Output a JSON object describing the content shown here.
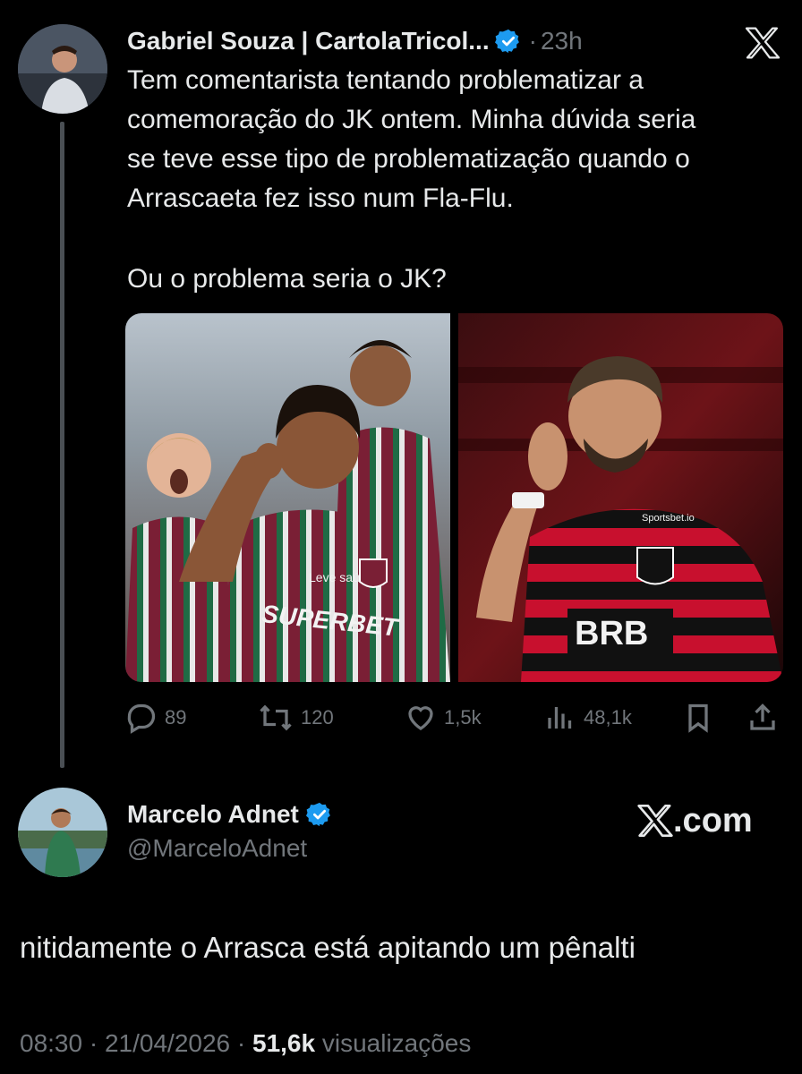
{
  "parent_tweet": {
    "author_name": "Gabriel Souza | CartolaTricol...",
    "time": "23h",
    "text_lines": [
      "Tem comentarista tentando problematizar a",
      "comemoração do JK ontem. Minha dúvida seria",
      "se teve esse tipo de problematização quando o",
      "Arrascaeta fez isso num Fla-Flu."
    ],
    "text_line2": "Ou o problema seria o JK?",
    "images": [
      {
        "desc_icon": "photo-fluminense-player",
        "shirt_sponsor": "SUPERBET",
        "shirt_brand": "Leve saúde"
      },
      {
        "desc_icon": "photo-flamengo-player",
        "shirt_sponsor": "BRB",
        "shirt_brand": "Sportsbet.io"
      }
    ],
    "actions": {
      "replies": "89",
      "retweets": "120",
      "likes": "1,5k",
      "views": "48,1k"
    }
  },
  "reply_tweet": {
    "author_name": "Marcelo Adnet",
    "handle": "@MarceloAdnet",
    "text": "nitidamente o Arrasca está apitando um pênalti",
    "time": "08:30",
    "date": "21/04/2026",
    "views_count": "51,6k",
    "views_label": "visualizações"
  },
  "watermark": {
    "logo_text": ".com"
  },
  "colors": {
    "background": "#000000",
    "text": "#e7e9ea",
    "muted": "#71767b",
    "verified": "#1d9bf0",
    "fluminense_maroon": "#7a1f35",
    "fluminense_green": "#1f6b45",
    "flamengo_red": "#c8102e"
  }
}
